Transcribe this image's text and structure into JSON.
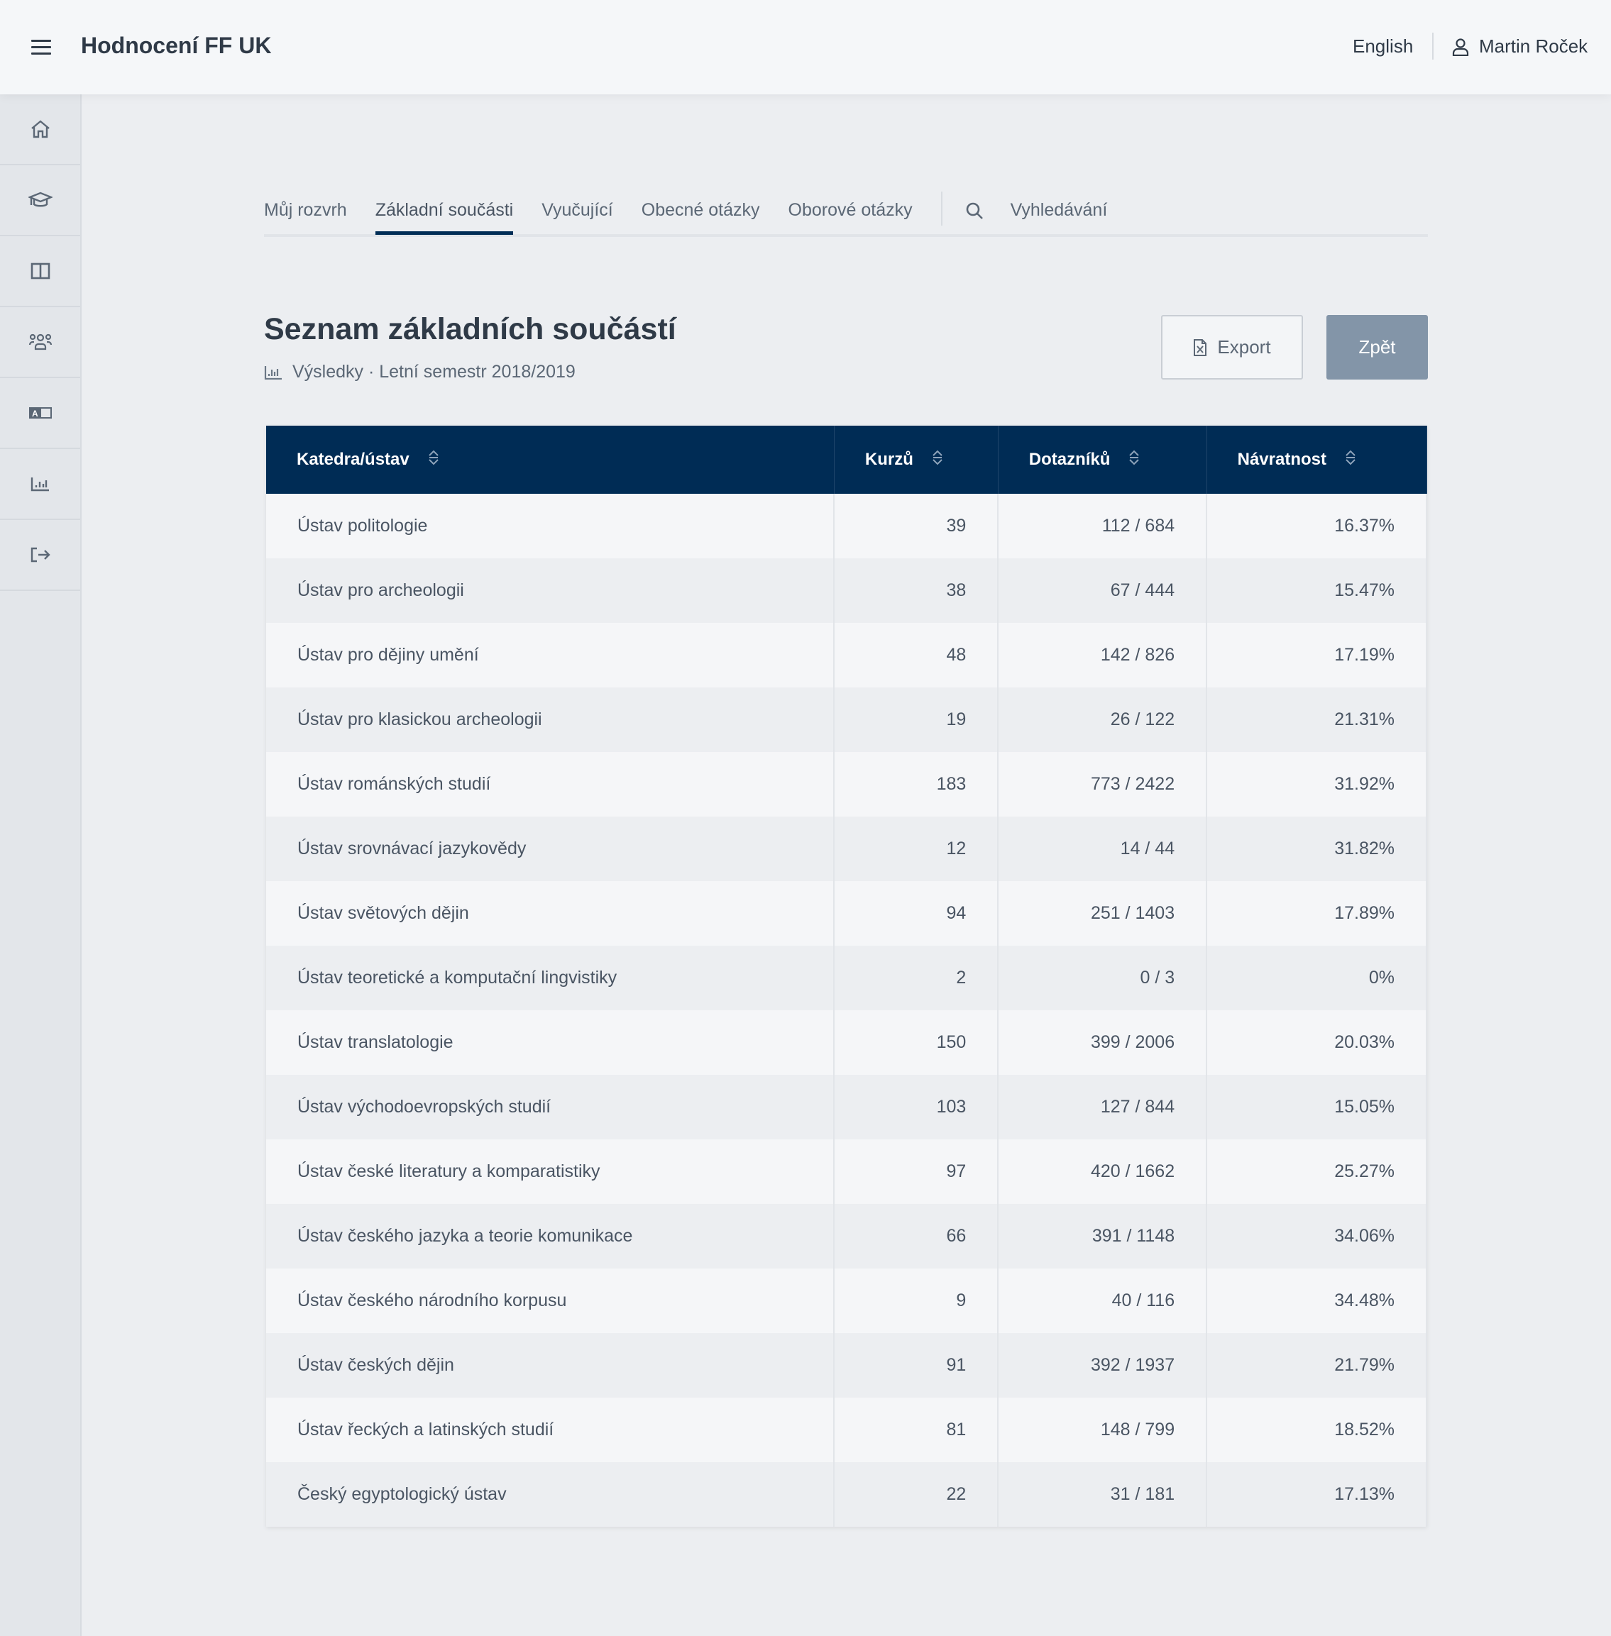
{
  "header": {
    "title": "Hodnocení FF UK",
    "language": "English",
    "user": "Martin Roček"
  },
  "sidebar": {
    "items": [
      {
        "icon": "home-icon"
      },
      {
        "icon": "graduation-cap-icon"
      },
      {
        "icon": "columns-icon"
      },
      {
        "icon": "users-icon"
      },
      {
        "icon": "translate-icon"
      },
      {
        "icon": "bar-chart-icon"
      },
      {
        "icon": "logout-icon"
      }
    ]
  },
  "tabs": [
    {
      "label": "Můj rozvrh"
    },
    {
      "label": "Základní součásti",
      "active": true
    },
    {
      "label": "Vyučující"
    },
    {
      "label": "Obecné otázky"
    },
    {
      "label": "Oborové otázky"
    }
  ],
  "search": {
    "label": "Vyhledávání"
  },
  "page": {
    "title": "Seznam základních součástí",
    "subtitle": "Výsledky · Letní semestr 2018/2019",
    "export_label": "Export",
    "back_label": "Zpět"
  },
  "table": {
    "columns": [
      "Katedra/ústav",
      "Kurzů",
      "Dotazníků",
      "Návratnost"
    ],
    "rows": [
      [
        "Ústav politologie",
        "39",
        "112 / 684",
        "16.37%"
      ],
      [
        "Ústav pro archeologii",
        "38",
        "67 / 444",
        "15.47%"
      ],
      [
        "Ústav pro dějiny umění",
        "48",
        "142 / 826",
        "17.19%"
      ],
      [
        "Ústav pro klasickou archeologii",
        "19",
        "26 / 122",
        "21.31%"
      ],
      [
        "Ústav románských studií",
        "183",
        "773 / 2422",
        "31.92%"
      ],
      [
        "Ústav srovnávací jazykovědy",
        "12",
        "14 / 44",
        "31.82%"
      ],
      [
        "Ústav světových dějin",
        "94",
        "251 / 1403",
        "17.89%"
      ],
      [
        "Ústav teoretické a komputační lingvistiky",
        "2",
        "0 / 3",
        "0%"
      ],
      [
        "Ústav translatologie",
        "150",
        "399 / 2006",
        "20.03%"
      ],
      [
        "Ústav východoevropských studií",
        "103",
        "127 / 844",
        "15.05%"
      ],
      [
        "Ústav české literatury a komparatistiky",
        "97",
        "420 / 1662",
        "25.27%"
      ],
      [
        "Ústav českého jazyka a teorie komunikace",
        "66",
        "391 / 1148",
        "34.06%"
      ],
      [
        "Ústav českého národního korpusu",
        "9",
        "40 / 116",
        "34.48%"
      ],
      [
        "Ústav českých dějin",
        "91",
        "392 / 1937",
        "21.79%"
      ],
      [
        "Ústav řeckých a latinských studií",
        "81",
        "148 / 799",
        "18.52%"
      ],
      [
        "Český egyptologický ústav",
        "22",
        "31 / 181",
        "17.13%"
      ]
    ]
  },
  "colors": {
    "header_bg": "#002c55",
    "accent": "#002c55",
    "back_button": "#8395a8"
  }
}
